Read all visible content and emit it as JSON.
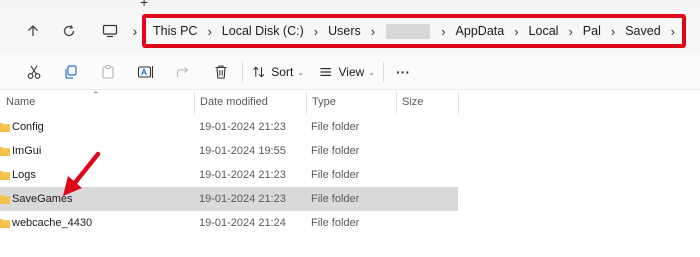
{
  "tabstrip": {
    "new_tab_symbol": "+"
  },
  "nav": {
    "up_icon": "arrow-up-icon",
    "refresh_icon": "refresh-icon",
    "pc_icon": "monitor-icon"
  },
  "breadcrumb": {
    "items": [
      "This PC",
      "Local Disk (C:)",
      "Users",
      "",
      "AppData",
      "Local",
      "Pal",
      "Saved"
    ],
    "separator": "›",
    "highlight_color": "#e0061a"
  },
  "toolbar": {
    "icons": [
      "cut-icon",
      "copy-icon",
      "paste-icon",
      "rename-icon",
      "share-icon",
      "delete-icon"
    ],
    "sort_label": "Sort",
    "view_label": "View",
    "more_label": "···"
  },
  "columns": {
    "name": "Name",
    "date": "Date modified",
    "type": "Type",
    "size": "Size"
  },
  "rows": [
    {
      "name": "Config",
      "date": "19-01-2024 21:23",
      "type": "File folder"
    },
    {
      "name": "ImGui",
      "date": "19-01-2024 19:55",
      "type": "File folder"
    },
    {
      "name": "Logs",
      "date": "19-01-2024 21:23",
      "type": "File folder"
    },
    {
      "name": "SaveGames",
      "date": "19-01-2024 21:23",
      "type": "File folder",
      "selected": true
    },
    {
      "name": "webcache_4430",
      "date": "19-01-2024 21:24",
      "type": "File folder"
    }
  ],
  "colors": {
    "selected_row": "#d9d9d9",
    "folder": "#f2c34a",
    "annotation": "#e0061a"
  }
}
